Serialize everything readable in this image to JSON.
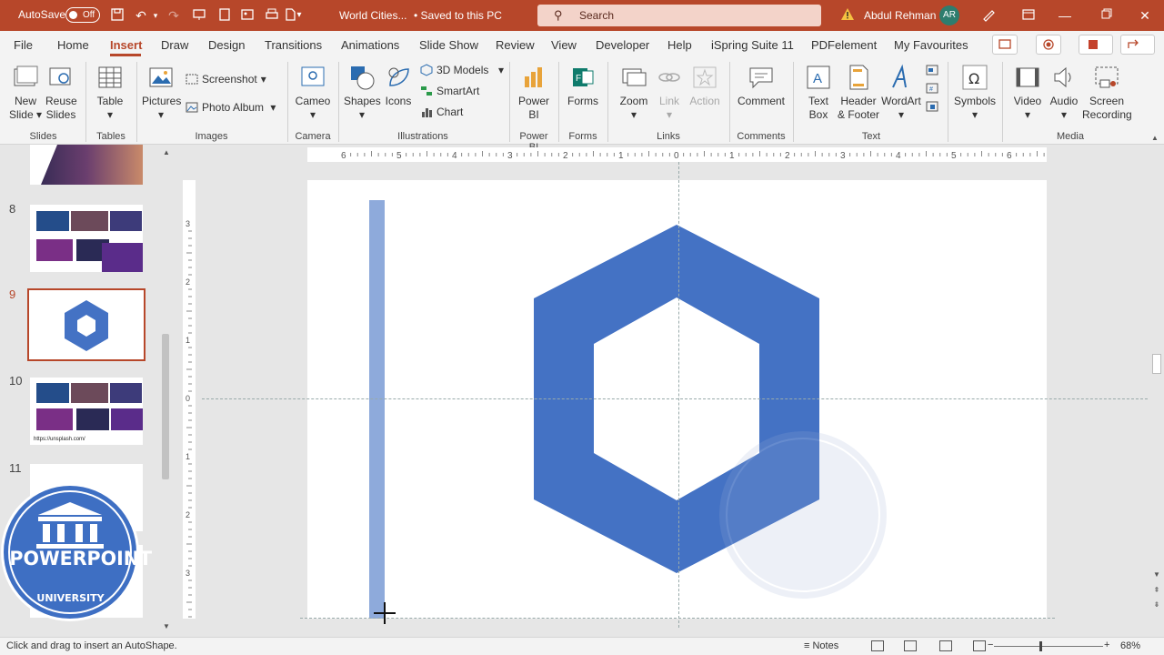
{
  "titlebar": {
    "autosave_label": "AutoSave",
    "autosave_state": "Off",
    "document_name": "World Cities...",
    "save_status": "• Saved to this PC",
    "search_placeholder": "Search",
    "user_name": "Abdul Rehman",
    "user_initials": "AR",
    "bg_color": "#b7472a"
  },
  "menu": {
    "tabs": [
      "File",
      "Home",
      "Insert",
      "Draw",
      "Design",
      "Transitions",
      "Animations",
      "Slide Show",
      "Review",
      "View",
      "Developer",
      "Help",
      "iSpring Suite 11",
      "PDFelement",
      "My Favourites"
    ],
    "active_tab": "Insert"
  },
  "ribbon": {
    "slides": {
      "new_slide": "New",
      "new_slide_2": "Slide",
      "reuse": "Reuse",
      "reuse_2": "Slides",
      "group": "Slides"
    },
    "tables": {
      "table": "Table",
      "group": "Tables"
    },
    "images": {
      "pictures": "Pictures",
      "screenshot": "Screenshot",
      "photo_album": "Photo Album",
      "group": "Images"
    },
    "camera": {
      "cameo": "Cameo",
      "group": "Camera"
    },
    "illustrations": {
      "shapes": "Shapes",
      "icons": "Icons",
      "models": "3D Models",
      "smartart": "SmartArt",
      "chart": "Chart",
      "group": "Illustrations"
    },
    "powerbi": {
      "label": "Power",
      "label_2": "BI",
      "group": "Power BI"
    },
    "forms": {
      "label": "Forms",
      "group": "Forms"
    },
    "links": {
      "zoom": "Zoom",
      "link": "Link",
      "action": "Action",
      "group": "Links"
    },
    "comments": {
      "comment": "Comment",
      "group": "Comments"
    },
    "text": {
      "textbox": "Text",
      "textbox_2": "Box",
      "header": "Header",
      "header_2": "& Footer",
      "wordart": "WordArt",
      "group": "Text"
    },
    "symbols": {
      "label": "Symbols"
    },
    "media": {
      "video": "Video",
      "audio": "Audio",
      "recording": "Screen",
      "recording_2": "Recording",
      "group": "Media"
    }
  },
  "thumbnails": {
    "slides": [
      {
        "number": "8"
      },
      {
        "number": "9"
      },
      {
        "number": "10",
        "caption": "https://unsplash.com/"
      },
      {
        "number": "11"
      }
    ],
    "current": "9"
  },
  "logo": {
    "text_main": "POWERPOINT",
    "text_sub": "UNIVERSITY"
  },
  "ruler": {
    "h_labels": [
      "6",
      "5",
      "4",
      "3",
      "2",
      "1",
      "0",
      "1",
      "2",
      "3",
      "4",
      "5",
      "6"
    ],
    "v_labels": [
      "3",
      "2",
      "1",
      "0",
      "1",
      "2",
      "3"
    ]
  },
  "canvas": {
    "hexagon_color": "#4472c4",
    "rect_color": "#8eaadb"
  },
  "status": {
    "hint": "Click and drag to insert an AutoShape.",
    "notes": "Notes",
    "zoom": "68%"
  }
}
